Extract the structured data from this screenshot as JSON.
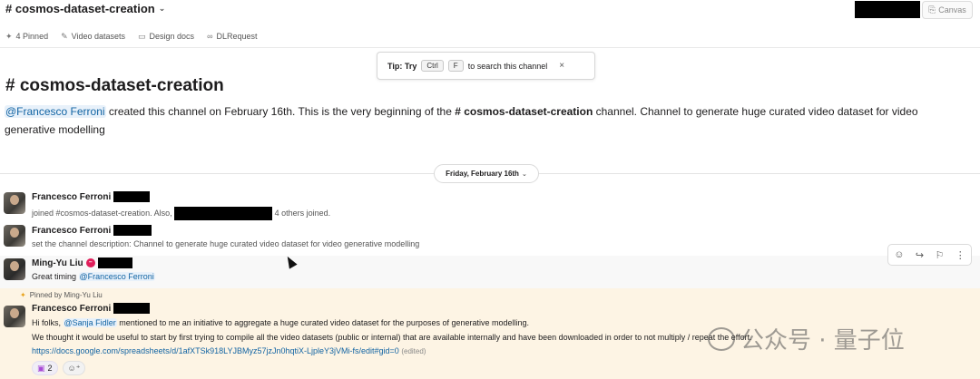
{
  "header": {
    "channel_name": "# cosmos-dataset-creation",
    "canvas_label": "Canvas"
  },
  "bookmarks": [
    {
      "label": "4 Pinned",
      "icon": "pin-icon"
    },
    {
      "label": "Video datasets",
      "icon": "pencil-icon"
    },
    {
      "label": "Design docs",
      "icon": "folder-icon"
    },
    {
      "label": "DLRequest",
      "icon": "link-icon"
    }
  ],
  "tip": {
    "prefix": "Tip: Try",
    "key1": "Ctrl",
    "key2": "F",
    "suffix": "to search this channel"
  },
  "intro": {
    "title": "# cosmos-dataset-creation",
    "mention": "@Francesco Ferroni",
    "text_a": " created this channel on February 16th. This is the very beginning of the ",
    "channel_ref": "# cosmos-dataset-creation",
    "text_b": " channel. Channel to generate huge curated video dataset for video generative modelling"
  },
  "date_divider": "Friday, February 16th",
  "messages": [
    {
      "sender": "Francesco Ferroni",
      "text_a": "joined #cosmos-dataset-creation. Also,",
      "text_b": "4 others joined."
    },
    {
      "sender": "Francesco Ferroni",
      "text": "set the channel description: Channel to generate huge curated video dataset for video generative modelling"
    },
    {
      "sender": "Ming-Yu Liu",
      "text": "Great timing",
      "mention": "@Francesco Ferroni"
    },
    {
      "pinned_by": "Pinned by Ming-Yu Liu",
      "sender": "Francesco Ferroni",
      "line1_a": "Hi folks,",
      "line1_mention": "@Sanja Fidler",
      "line1_b": "mentioned to me an initiative to aggregate a huge curated video dataset for the purposes of generative modelling.",
      "line2": "We thought it would be useful to start by first trying to compile all the video datasets (public or internal) that are available internally and have been downloaded in order to not multiply / repeat the effort.",
      "link": "https://docs.google.com/spreadsheets/d/1afXTSk918LYJBMyz57jzJn0hqtiX-LjpleY3jVMi-fs/edit#gid=0",
      "edited": "(edited)",
      "reaction_count": "2"
    }
  ],
  "watermark": "公众号 · 量子位"
}
